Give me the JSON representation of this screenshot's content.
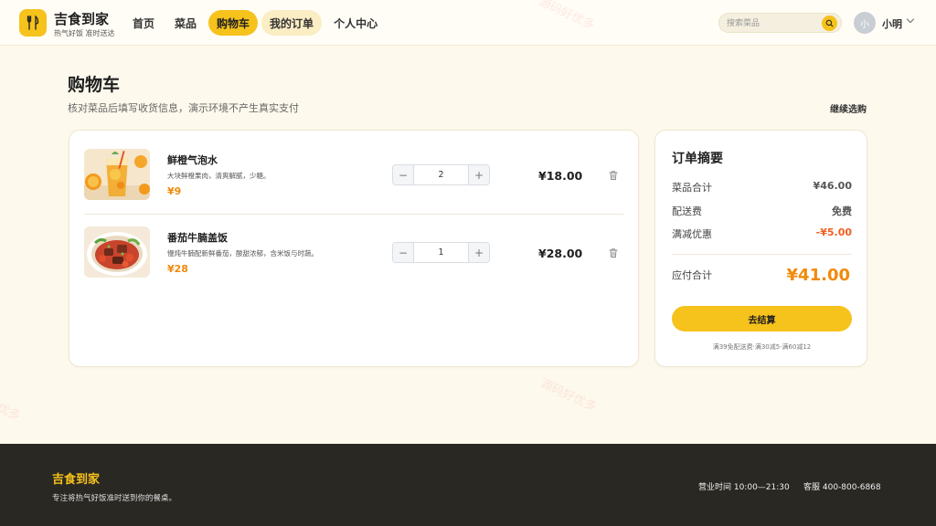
{
  "header": {
    "brand_name": "吉食到家",
    "slogan": "热气好饭 准时送达",
    "nav": [
      {
        "label": "首页"
      },
      {
        "label": "菜品"
      },
      {
        "label": "购物车"
      },
      {
        "label": "我的订单"
      },
      {
        "label": "个人中心"
      }
    ],
    "search_placeholder": "搜索菜品",
    "avatar_initial": "小",
    "username": "小明"
  },
  "page": {
    "title": "购物车",
    "subtitle": "核对菜品后填写收货信息，演示环境不产生真实支付",
    "continue_link": "继续选购"
  },
  "cart": {
    "items": [
      {
        "name": "鲜橙气泡水",
        "desc": "大块鲜橙果肉，清爽解腻，少糖。",
        "unit_price": "¥9",
        "quantity": "2",
        "line_total": "¥18.00"
      },
      {
        "name": "番茄牛腩盖饭",
        "desc": "慢炖牛腩配新鲜番茄，酸甜浓郁，含米饭与时蔬。",
        "unit_price": "¥28",
        "quantity": "1",
        "line_total": "¥28.00"
      }
    ],
    "minus_label": "−",
    "plus_label": "+"
  },
  "summary": {
    "title": "订单摘要",
    "rows": [
      {
        "label": "菜品合计",
        "value": "¥46.00"
      },
      {
        "label": "配送费",
        "value": "免费"
      },
      {
        "label": "满减优惠",
        "value": "-¥5.00"
      }
    ],
    "payable_label": "应付合计",
    "payable_value": "¥41.00",
    "checkout_label": "去结算",
    "promo_note": "满39免配送费·满30减5·满60减12"
  },
  "footer": {
    "brand": "吉食到家",
    "tagline": "专注将热气好饭准时送到你的餐桌。",
    "hours": "营业时间 10:00—21:30",
    "service": "客服 400-800-6868"
  },
  "watermark": "源码好优多",
  "colors": {
    "accent": "#f6c21c",
    "price": "#f08a0c",
    "discount": "#f0601e",
    "page_bg": "#fdf9ec",
    "footer_bg": "#2a2823"
  }
}
